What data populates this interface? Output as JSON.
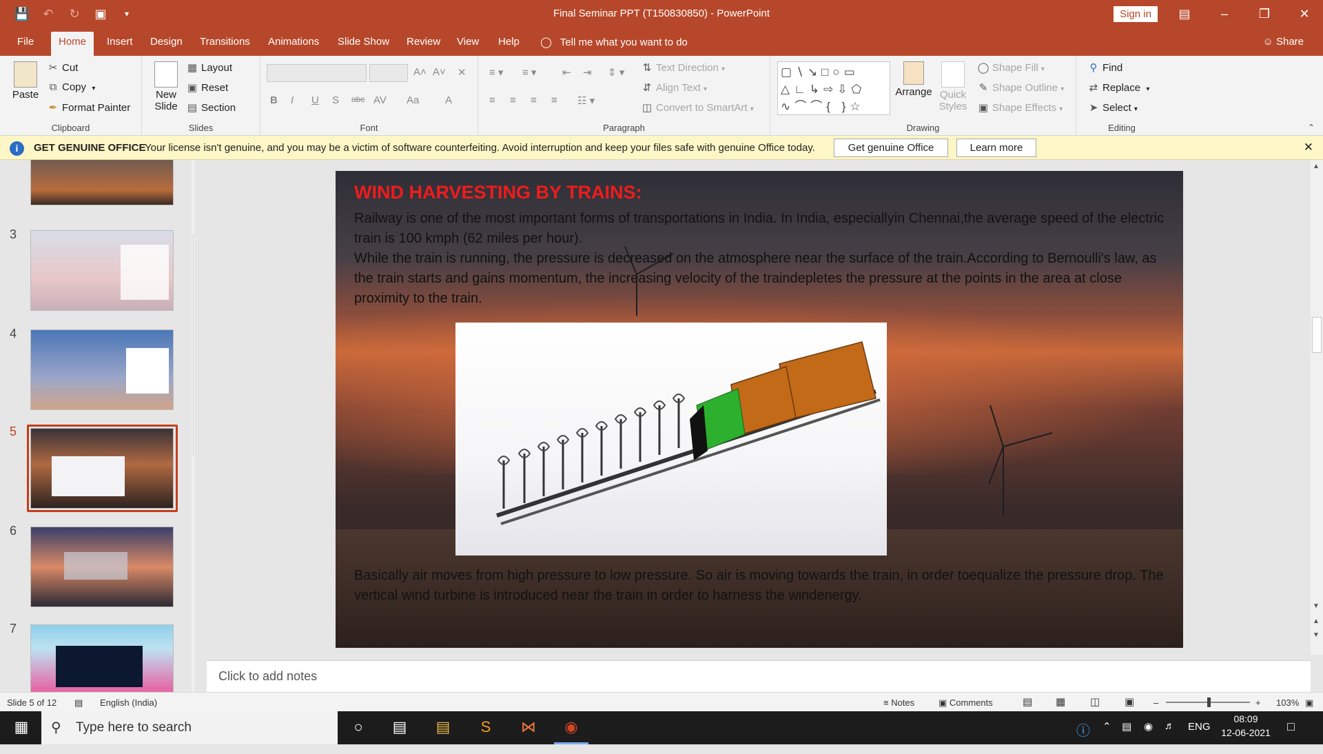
{
  "window": {
    "title": "Final Seminar PPT (T150830850)  -  PowerPoint",
    "sign_in": "Sign in",
    "qat_icons": [
      "save-icon",
      "undo-icon",
      "redo-icon",
      "present-icon",
      "customize-icon"
    ],
    "controls": [
      "ribbon-display-icon",
      "minimize-icon",
      "maximize-icon",
      "close-icon"
    ]
  },
  "tabs": [
    "File",
    "Home",
    "Insert",
    "Design",
    "Transitions",
    "Animations",
    "Slide Show",
    "Review",
    "View",
    "Help"
  ],
  "active_tab": "Home",
  "tell_me": "Tell me what you want to do",
  "share": "Share",
  "ribbon": {
    "clipboard": {
      "paste": "Paste",
      "cut": "Cut",
      "copy": "Copy",
      "format_painter": "Format Painter",
      "label": "Clipboard"
    },
    "slides": {
      "new_slide_1": "New",
      "new_slide_2": "Slide",
      "layout": "Layout",
      "reset": "Reset",
      "section": "Section",
      "label": "Slides"
    },
    "font": {
      "label": "Font",
      "buttons": [
        "B",
        "I",
        "U",
        "S",
        "abc",
        "AV",
        "Aa",
        "A"
      ]
    },
    "paragraph": {
      "text_direction": "Text Direction",
      "align_text": "Align Text",
      "convert_smartart": "Convert to SmartArt",
      "label": "Paragraph"
    },
    "drawing": {
      "arrange": "Arrange",
      "quick_1": "Quick",
      "quick_2": "Styles",
      "shape_fill": "Shape Fill",
      "shape_outline": "Shape Outline",
      "shape_effects": "Shape Effects",
      "label": "Drawing"
    },
    "editing": {
      "find": "Find",
      "replace": "Replace",
      "select": "Select",
      "label": "Editing"
    }
  },
  "banner": {
    "title": "GET GENUINE OFFICE",
    "message": "Your license isn't genuine, and you may be a victim of software counterfeiting. Avoid interruption and keep your files safe with genuine Office today.",
    "btn_genuine": "Get genuine Office",
    "btn_learn": "Learn more"
  },
  "thumbnails": [
    {
      "num": "3"
    },
    {
      "num": "4"
    },
    {
      "num": "5"
    },
    {
      "num": "6"
    },
    {
      "num": "7"
    }
  ],
  "slide": {
    "title": "WIND HARVESTING BY TRAINS:",
    "p1": " Railway is one of the most important forms of transportations in India. In India, especiallyin Chennai,the average speed of the electric train is 100 kmph (62 miles per hour).",
    "p2": "While the train is running, the pressure is decreased on the atmosphere near the surface of the train.According to Bernoulli's law, as the train starts and gains momentum, the increasing velocity of the traindepletes the pressure at the points in the area at close proximity to the train.",
    "p3": "Basically air moves from high pressure to low pressure. So air is moving towards the train, in order toequalize the pressure drop. The vertical wind turbine is introduced near the train in order to harness the windenergy."
  },
  "notes_placeholder": "Click to add notes",
  "status": {
    "slide_of": "Slide 5 of 12",
    "language": "English (India)",
    "notes": "Notes",
    "comments": "Comments",
    "zoom": "103%"
  },
  "taskbar": {
    "search_placeholder": "Type here to search",
    "lang": "ENG",
    "time": "08:09",
    "date": "12-06-2021"
  },
  "colors": {
    "accent": "#b7472a",
    "title_red": "#ee1c1c",
    "selection": "#c43e1c"
  }
}
